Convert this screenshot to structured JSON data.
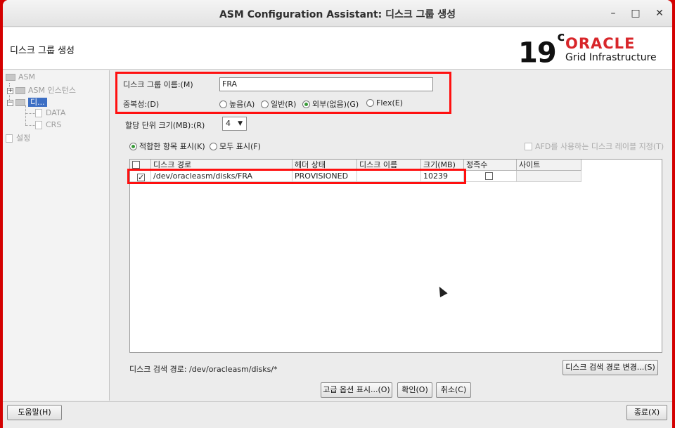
{
  "window": {
    "title": "ASM Configuration Assistant: 디스크 그룹 생성",
    "minimize_glyph": "–",
    "maximize_glyph": "□",
    "close_glyph": "✕"
  },
  "header": {
    "page_title": "디스크 그룹 생성",
    "logo_version": "19",
    "logo_version_suffix": "c",
    "logo_brand": "ORACLE",
    "logo_product": "Grid Infrastructure"
  },
  "sidebar": {
    "items": [
      {
        "label": "ASM"
      },
      {
        "label": "ASM 인스턴스"
      },
      {
        "label": "디..."
      },
      {
        "label": "DATA"
      },
      {
        "label": "CRS"
      },
      {
        "label": "설정"
      }
    ]
  },
  "form": {
    "group_name_label": "디스크 그룹 이름:(M)",
    "group_name_value": "FRA",
    "redundancy_label": "중복성:(D)",
    "redundancy_options": [
      {
        "label": "높음(A)",
        "selected": false
      },
      {
        "label": "일반(R)",
        "selected": false
      },
      {
        "label": "외부(없음)(G)",
        "selected": true
      },
      {
        "label": "Flex(E)",
        "selected": false
      }
    ],
    "au_size_label": "할당 단위 크기(MB):(R)",
    "au_size_value": "4",
    "show_eligible_label": "적합한 항목 표시(K)",
    "show_all_label": "모두 표시(F)",
    "afd_label": "AFD를 사용하는 디스크 레이블 지정(T)"
  },
  "table": {
    "columns": [
      "",
      "디스크 경로",
      "헤더 상태",
      "디스크 이름",
      "크기(MB)",
      "정족수",
      "사이트"
    ],
    "rows": [
      {
        "checked": true,
        "path": "/dev/oracleasm/disks/FRA",
        "header_status": "PROVISIONED",
        "disk_name": "",
        "size": "10239",
        "quorum": false,
        "site": ""
      }
    ]
  },
  "discovery": {
    "path_label": "디스크 검색 경로: /dev/oracleasm/disks/*",
    "change_button": "디스크 검색 경로 변경...(S)"
  },
  "buttons": {
    "advanced": "고급 옵션 표시...(O)",
    "ok": "확인(O)",
    "cancel": "취소(C)",
    "help": "도움말(H)",
    "exit": "종료(X)"
  },
  "colors": {
    "highlight": "#ff1010",
    "oracle_red": "#d8262a",
    "selection": "#3d6fc4"
  }
}
